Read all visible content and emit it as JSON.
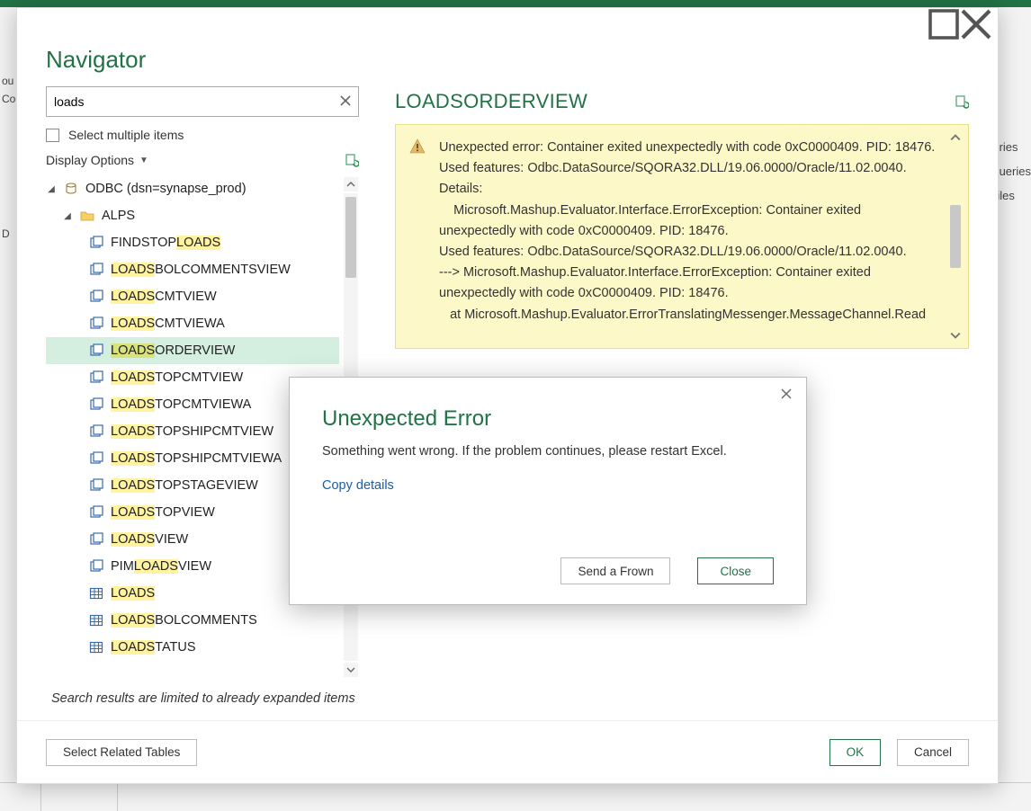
{
  "excel_hints": {
    "left_1": "ou",
    "left_2": "Co",
    "right_1": "ieries",
    "right_2": "Queries",
    "right_3": "Files",
    "cell_letter": "D"
  },
  "navigator": {
    "title": "Navigator",
    "search_value": "loads",
    "multi_label": "Select multiple items",
    "display_options": "Display Options",
    "root_label": "ODBC (dsn=synapse_prod)",
    "folder_label": "ALPS",
    "items": [
      {
        "pre": "FINDSTOP",
        "hl": "LOADS",
        "post": "",
        "type": "view",
        "selected": false
      },
      {
        "pre": "",
        "hl": "LOADS",
        "post": "BOLCOMMENTSVIEW",
        "type": "view",
        "selected": false
      },
      {
        "pre": "",
        "hl": "LOADS",
        "post": "CMTVIEW",
        "type": "view",
        "selected": false
      },
      {
        "pre": "",
        "hl": "LOADS",
        "post": "CMTVIEWA",
        "type": "view",
        "selected": false
      },
      {
        "pre": "",
        "hl": "LOADS",
        "post": "ORDERVIEW",
        "type": "view",
        "selected": true
      },
      {
        "pre": "",
        "hl": "LOADS",
        "post": "TOPCMTVIEW",
        "type": "view",
        "selected": false
      },
      {
        "pre": "",
        "hl": "LOADS",
        "post": "TOPCMTVIEWA",
        "type": "view",
        "selected": false
      },
      {
        "pre": "",
        "hl": "LOADS",
        "post": "TOPSHIPCMTVIEW",
        "type": "view",
        "selected": false
      },
      {
        "pre": "",
        "hl": "LOADS",
        "post": "TOPSHIPCMTVIEWA",
        "type": "view",
        "selected": false
      },
      {
        "pre": "",
        "hl": "LOADS",
        "post": "TOPSTAGEVIEW",
        "type": "view",
        "selected": false
      },
      {
        "pre": "",
        "hl": "LOADS",
        "post": "TOPVIEW",
        "type": "view",
        "selected": false
      },
      {
        "pre": "",
        "hl": "LOADS",
        "post": "VIEW",
        "type": "view",
        "selected": false
      },
      {
        "pre": "PIM",
        "hl": "LOADS",
        "post": "VIEW",
        "type": "view",
        "selected": false
      },
      {
        "pre": "",
        "hl": "LOADS",
        "post": "",
        "type": "table",
        "selected": false
      },
      {
        "pre": "",
        "hl": "LOADS",
        "post": "BOLCOMMENTS",
        "type": "table",
        "selected": false
      },
      {
        "pre": "",
        "hl": "LOADS",
        "post": "TATUS",
        "type": "table",
        "selected": false
      }
    ],
    "limit_note": "Search results are limited to already expanded items",
    "footer": {
      "related": "Select Related Tables",
      "ok": "OK",
      "cancel": "Cancel"
    }
  },
  "preview": {
    "title": "LOADSORDERVIEW",
    "error_lines": [
      "Unexpected error: Container exited unexpectedly with code 0xC0000409. PID: 18476.",
      "Used features: Odbc.DataSource/SQORA32.DLL/19.06.0000/Oracle/11.02.0040.",
      "Details:",
      "    Microsoft.Mashup.Evaluator.Interface.ErrorException: Container exited unexpectedly with code 0xC0000409. PID: 18476.",
      "Used features: Odbc.DataSource/SQORA32.DLL/19.06.0000/Oracle/11.02.0040.",
      "---> Microsoft.Mashup.Evaluator.Interface.ErrorException: Container exited unexpectedly with code 0xC0000409. PID: 18476.",
      "   at Microsoft.Mashup.Evaluator.ErrorTranslatingMessenger.MessageChannel.Read"
    ]
  },
  "modal": {
    "title": "Unexpected Error",
    "body": "Something went wrong. If the problem continues, please restart Excel.",
    "copy": "Copy details",
    "frown": "Send a Frown",
    "close": "Close"
  }
}
